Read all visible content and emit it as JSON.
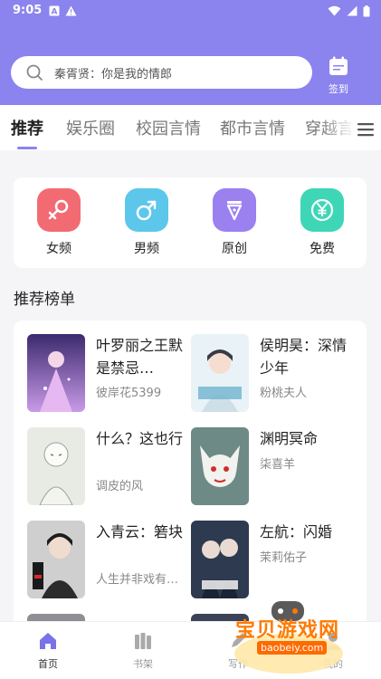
{
  "status_bar": {
    "time": "9:05"
  },
  "search": {
    "placeholder": "秦胥贤：你是我的情郎"
  },
  "sign_in": {
    "label": "签到",
    "icon": "calendar-icon"
  },
  "tabs": [
    {
      "label": "推荐"
    },
    {
      "label": "娱乐圈"
    },
    {
      "label": "校园言情"
    },
    {
      "label": "都市言情"
    },
    {
      "label": "穿越言"
    }
  ],
  "categories": [
    {
      "label": "女频",
      "icon": "female-icon",
      "color": "#f26b73"
    },
    {
      "label": "男频",
      "icon": "male-icon",
      "color": "#5cc7ea"
    },
    {
      "label": "原创",
      "icon": "pen-nib-icon",
      "color": "#9b80f0"
    },
    {
      "label": "免费",
      "icon": "yen-icon",
      "color": "#3fd6b7"
    }
  ],
  "section_title": "推荐榜单",
  "books": [
    {
      "title": "叶罗丽之王默是禁忌…",
      "author": "彼岸花5399"
    },
    {
      "title": "侯明昊：深情少年",
      "author": "粉桃夫人"
    },
    {
      "title": "什么？这也行",
      "author": "调皮的风"
    },
    {
      "title": "渊明冥命",
      "author": "柒喜羊"
    },
    {
      "title": "入青云：箬块",
      "author": "人生并非戏有…"
    },
    {
      "title": "左航：闪婚",
      "author": "茉莉佑子"
    }
  ],
  "bottom_nav": [
    {
      "label": "首页",
      "icon": "home-icon"
    },
    {
      "label": "书架",
      "icon": "bookshelf-icon"
    },
    {
      "label": "写作",
      "icon": "write-icon"
    },
    {
      "label": "我的",
      "icon": "profile-icon"
    }
  ],
  "watermark": {
    "site": "宝贝游戏网",
    "url": "baobeiy.com"
  },
  "colors": {
    "accent": "#8b83ee",
    "tab_indicator": "#8b83ee"
  }
}
